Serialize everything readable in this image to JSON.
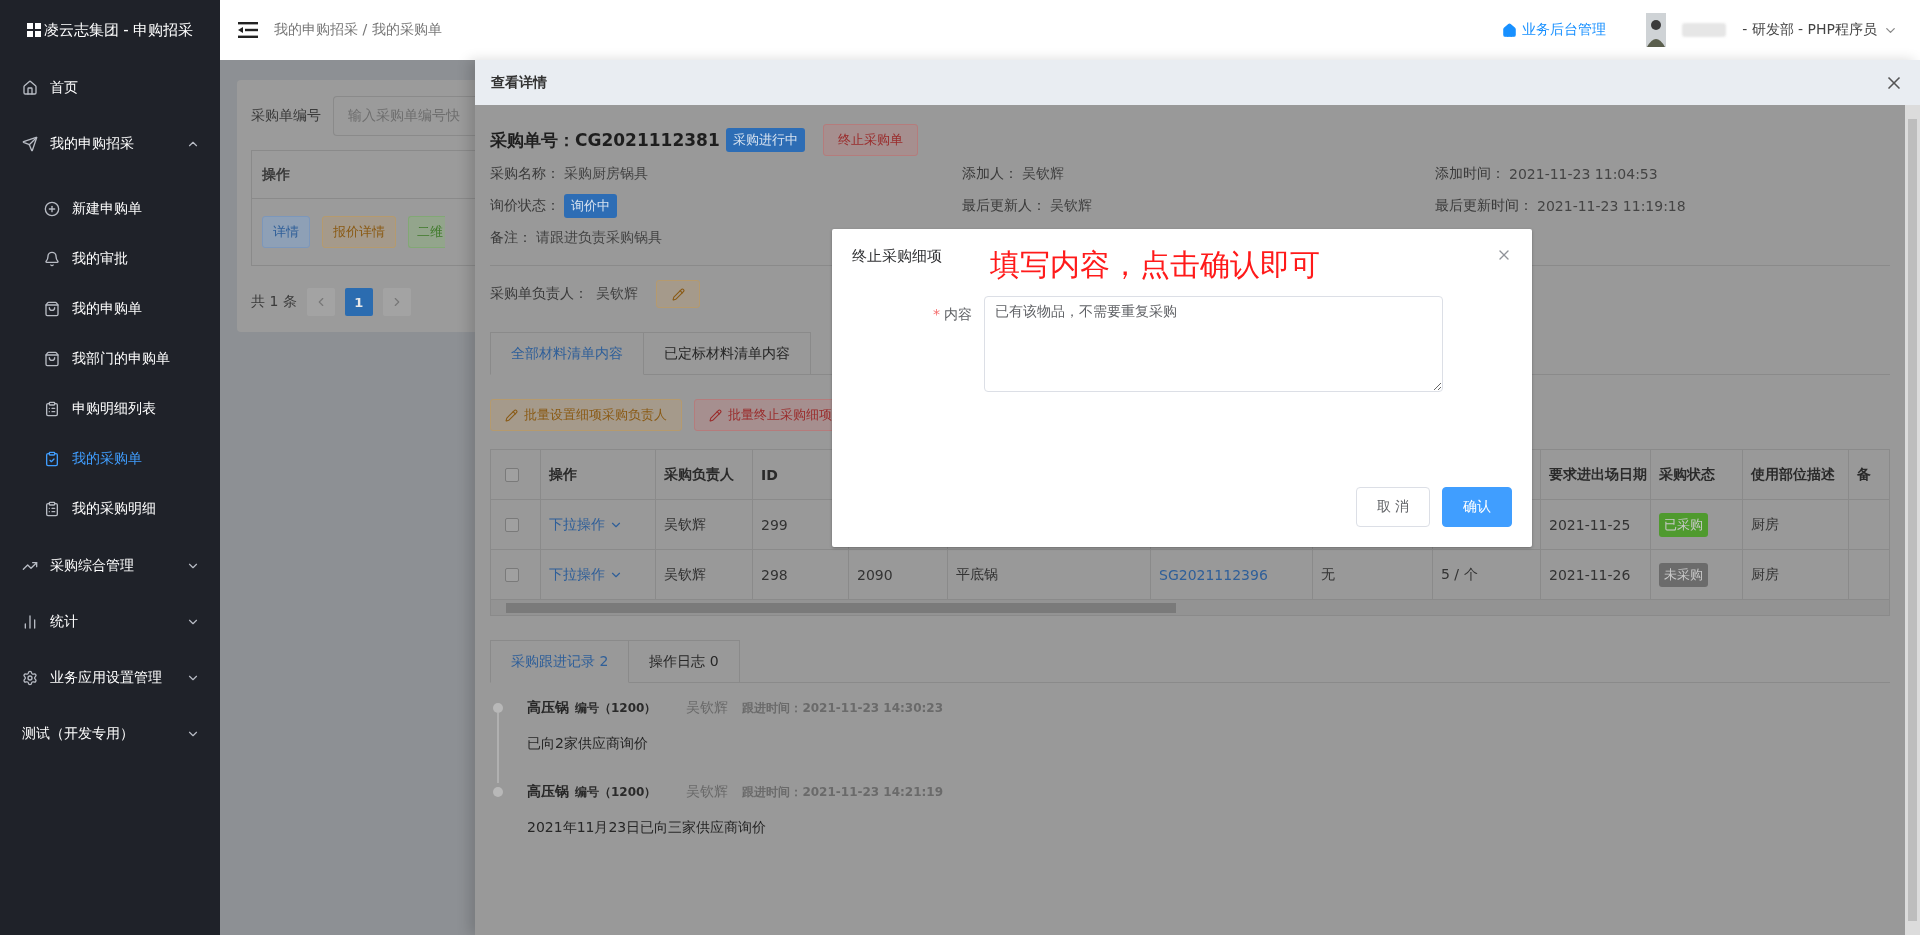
{
  "sidebar": {
    "title": "凌云志集团 - 申购招采",
    "items": [
      {
        "label": "首页",
        "selected": false
      },
      {
        "label": "我的申购招采",
        "selected": false,
        "expanded": true,
        "children": [
          {
            "label": "新建申购单",
            "selected": false
          },
          {
            "label": "我的审批",
            "selected": false
          },
          {
            "label": "我的申购单",
            "selected": false
          },
          {
            "label": "我部门的申购单",
            "selected": false
          },
          {
            "label": "申购明细列表",
            "selected": false
          },
          {
            "label": "我的采购单",
            "selected": true
          },
          {
            "label": "我的采购明细",
            "selected": false
          }
        ]
      },
      {
        "label": "采购综合管理",
        "selected": false,
        "expanded": false
      },
      {
        "label": "统计",
        "selected": false,
        "expanded": false
      },
      {
        "label": "业务应用设置管理",
        "selected": false,
        "expanded": false
      },
      {
        "label": "测试（开发专用）",
        "selected": false,
        "expanded": false
      }
    ]
  },
  "header": {
    "breadcrumb": "我的申购招采 / 我的采购单",
    "admin_link": "业务后台管理",
    "user_role": "- 研发部 - PHP程序员"
  },
  "page": {
    "filter_label": "采购单编号",
    "filter_placeholder": "输入采购单编号快",
    "table_header": "操作",
    "row_buttons": [
      {
        "label": "详情",
        "kind": "info"
      },
      {
        "label": "报价详情",
        "kind": "warning"
      },
      {
        "label": "二维",
        "kind": "success"
      }
    ],
    "total": "共 1 条",
    "pages": [
      {
        "label": "1",
        "selected": true
      }
    ]
  },
  "drawer": {
    "title": "查看详情",
    "order_label": "采购单号：",
    "order_no": "CG2021112381",
    "status_tag": "采购进行中",
    "stop_button": "终止采购单",
    "fields": [
      {
        "label": "采购名称：",
        "value": "采购厨房锅具",
        "kind": "text"
      },
      {
        "label": "添加人：",
        "value": "吴钦辉",
        "kind": "text"
      },
      {
        "label": "添加时间：",
        "value": "2021-11-23 11:04:53",
        "kind": "text"
      },
      {
        "label": "询价状态：",
        "value": "询价中",
        "kind": "tag"
      },
      {
        "label": "最后更新人：",
        "value": "吴钦辉",
        "kind": "text"
      },
      {
        "label": "最后更新时间：",
        "value": "2021-11-23 11:19:18",
        "kind": "text"
      },
      {
        "label": "备注：",
        "value": "请跟进负责采购锅具",
        "kind": "text"
      }
    ],
    "owner": {
      "label": "采购单负责人：",
      "value": "吴钦辉"
    },
    "tabs": [
      {
        "label": "全部材料清单内容",
        "selected": true
      },
      {
        "label": "已定标材料清单内容",
        "selected": false
      }
    ],
    "batch_buttons": [
      {
        "label": "批量设置细项采购负责人",
        "kind": "warning"
      },
      {
        "label": "批量终止采购细项",
        "kind": "danger"
      }
    ],
    "table": {
      "header_checked": false,
      "columns": [
        "操作",
        "采购负责人",
        "ID",
        null,
        null,
        null,
        null,
        null,
        "要求进出场日期",
        "采购状态",
        "使用部位描述",
        "备"
      ],
      "rows": [
        {
          "checked": false,
          "cells": [
            {
              "text": "下拉操作",
              "kind": "dropdown"
            },
            {
              "text": "吴钦辉",
              "kind": "text"
            },
            {
              "text": "299",
              "kind": "text"
            },
            null,
            null,
            null,
            null,
            null,
            {
              "text": "2021-11-25",
              "kind": "text"
            },
            {
              "text": "已采购",
              "kind": "tag",
              "color": "#4f9a2e"
            },
            {
              "text": "厨房",
              "kind": "text"
            },
            null
          ]
        },
        {
          "checked": false,
          "cells": [
            {
              "text": "下拉操作",
              "kind": "dropdown"
            },
            {
              "text": "吴钦辉",
              "kind": "text"
            },
            {
              "text": "298",
              "kind": "text"
            },
            {
              "text": "2090",
              "kind": "text"
            },
            {
              "text": "平底锅",
              "kind": "text"
            },
            {
              "text": "SG2021112396",
              "kind": "link"
            },
            {
              "text": "无",
              "kind": "text"
            },
            {
              "text": "5 / 个",
              "kind": "text"
            },
            {
              "text": "2021-11-26",
              "kind": "text"
            },
            {
              "text": "未采购",
              "kind": "tag",
              "color": "#6b6b6b"
            },
            {
              "text": "厨房",
              "kind": "text"
            },
            null
          ]
        }
      ]
    },
    "log_tabs": [
      {
        "label": "采购跟进记录 2",
        "selected": true
      },
      {
        "label": "操作日志 0",
        "selected": false
      }
    ],
    "records": [
      {
        "item": "高压锅",
        "code": "编号（1200）",
        "person": "吴钦辉",
        "time": "跟进时间：2021-11-23 14:30:23",
        "note": "已向2家供应商询价"
      },
      {
        "item": "高压锅",
        "code": "编号（1200）",
        "person": "吴钦辉",
        "time": "跟进时间：2021-11-23 14:21:19",
        "note": "2021年11月23日已向三家供应商询价"
      }
    ]
  },
  "dialog": {
    "title": "终止采购细项",
    "annotation": "填写内容，点击确认即可",
    "required_mark": "*",
    "field_label": "内容",
    "value": "已有该物品，不需要重复采购",
    "buttons": [
      {
        "label": "取 消",
        "kind": "default"
      },
      {
        "label": "确认",
        "kind": "primary"
      }
    ]
  }
}
